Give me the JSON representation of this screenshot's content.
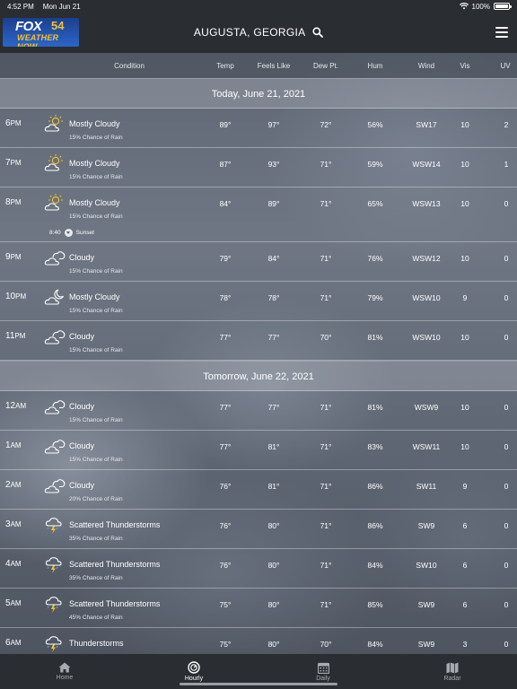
{
  "status_bar": {
    "time": "4:52 PM",
    "date": "Mon Jun 21",
    "battery": "100%"
  },
  "header": {
    "logo": {
      "brand": "FOX",
      "number": "54",
      "sub": "WEATHER NOW"
    },
    "location": "AUGUSTA, GEORGIA"
  },
  "columns": {
    "condition": "Condition",
    "temp": "Temp",
    "feels": "Feels Like",
    "dew": "Dew Pt.",
    "hum": "Hum",
    "wind": "Wind",
    "vis": "Vis",
    "uv": "UV"
  },
  "days": [
    {
      "label": "Today, June 21, 2021",
      "rows": [
        {
          "hour": "6",
          "ampm": "PM",
          "icon": "partly-cloudy-sun",
          "cond": "Mostly Cloudy",
          "rain": "15% Chance of Rain",
          "temp": "89°",
          "feels": "97°",
          "dew": "72°",
          "hum": "56%",
          "wind": "SW17",
          "vis": "10",
          "uv": "2"
        },
        {
          "hour": "7",
          "ampm": "PM",
          "icon": "partly-cloudy-sun",
          "cond": "Mostly Cloudy",
          "rain": "15% Chance of Rain",
          "temp": "87°",
          "feels": "93°",
          "dew": "71°",
          "hum": "59%",
          "wind": "WSW14",
          "vis": "10",
          "uv": "1"
        },
        {
          "hour": "8",
          "ampm": "PM",
          "icon": "partly-cloudy-sun",
          "cond": "Mostly Cloudy",
          "rain": "15% Chance of Rain",
          "temp": "84°",
          "feels": "89°",
          "dew": "71°",
          "hum": "65%",
          "wind": "WSW13",
          "vis": "10",
          "uv": "0",
          "event_time": "8:40",
          "event_label": "Sunset"
        },
        {
          "hour": "9",
          "ampm": "PM",
          "icon": "cloudy",
          "cond": "Cloudy",
          "rain": "15% Chance of Rain",
          "temp": "79°",
          "feels": "84°",
          "dew": "71°",
          "hum": "76%",
          "wind": "WSW12",
          "vis": "10",
          "uv": "0"
        },
        {
          "hour": "10",
          "ampm": "PM",
          "icon": "partly-cloudy-night",
          "cond": "Mostly Cloudy",
          "rain": "15% Chance of Rain",
          "temp": "78°",
          "feels": "78°",
          "dew": "71°",
          "hum": "79%",
          "wind": "WSW10",
          "vis": "9",
          "uv": "0"
        },
        {
          "hour": "11",
          "ampm": "PM",
          "icon": "cloudy",
          "cond": "Cloudy",
          "rain": "15% Chance of Rain",
          "temp": "77°",
          "feels": "77°",
          "dew": "70°",
          "hum": "81%",
          "wind": "WSW10",
          "vis": "10",
          "uv": "0"
        }
      ]
    },
    {
      "label": "Tomorrow, June 22, 2021",
      "rows": [
        {
          "hour": "12",
          "ampm": "AM",
          "icon": "cloudy",
          "cond": "Cloudy",
          "rain": "15% Chance of Rain",
          "temp": "77°",
          "feels": "77°",
          "dew": "71°",
          "hum": "81%",
          "wind": "WSW9",
          "vis": "10",
          "uv": "0"
        },
        {
          "hour": "1",
          "ampm": "AM",
          "icon": "cloudy",
          "cond": "Cloudy",
          "rain": "15% Chance of Rain",
          "temp": "77°",
          "feels": "81°",
          "dew": "71°",
          "hum": "83%",
          "wind": "WSW11",
          "vis": "10",
          "uv": "0"
        },
        {
          "hour": "2",
          "ampm": "AM",
          "icon": "cloudy",
          "cond": "Cloudy",
          "rain": "20% Chance of Rain",
          "temp": "76°",
          "feels": "81°",
          "dew": "71°",
          "hum": "86%",
          "wind": "SW11",
          "vis": "9",
          "uv": "0"
        },
        {
          "hour": "3",
          "ampm": "AM",
          "icon": "thunderstorm",
          "cond": "Scattered Thunderstorms",
          "rain": "35% Chance of Rain",
          "temp": "76°",
          "feels": "80°",
          "dew": "71°",
          "hum": "86%",
          "wind": "SW9",
          "vis": "6",
          "uv": "0"
        },
        {
          "hour": "4",
          "ampm": "AM",
          "icon": "thunderstorm",
          "cond": "Scattered Thunderstorms",
          "rain": "35% Chance of Rain",
          "temp": "76°",
          "feels": "80°",
          "dew": "71°",
          "hum": "84%",
          "wind": "SW10",
          "vis": "6",
          "uv": "0"
        },
        {
          "hour": "5",
          "ampm": "AM",
          "icon": "thunderstorm",
          "cond": "Scattered Thunderstorms",
          "rain": "45% Chance of Rain",
          "temp": "75°",
          "feels": "80°",
          "dew": "71°",
          "hum": "85%",
          "wind": "SW9",
          "vis": "6",
          "uv": "0"
        },
        {
          "hour": "6",
          "ampm": "AM",
          "icon": "thunderstorm",
          "cond": "Thunderstorms",
          "rain": "",
          "temp": "75°",
          "feels": "80°",
          "dew": "70°",
          "hum": "84%",
          "wind": "SW9",
          "vis": "3",
          "uv": "0"
        }
      ]
    }
  ],
  "tabs": [
    {
      "label": "Home",
      "icon": "home-icon",
      "active": false
    },
    {
      "label": "Hourly",
      "icon": "clock-icon",
      "active": true
    },
    {
      "label": "Daily",
      "icon": "calendar-icon",
      "active": false
    },
    {
      "label": "Radar",
      "icon": "map-icon",
      "active": false
    }
  ]
}
